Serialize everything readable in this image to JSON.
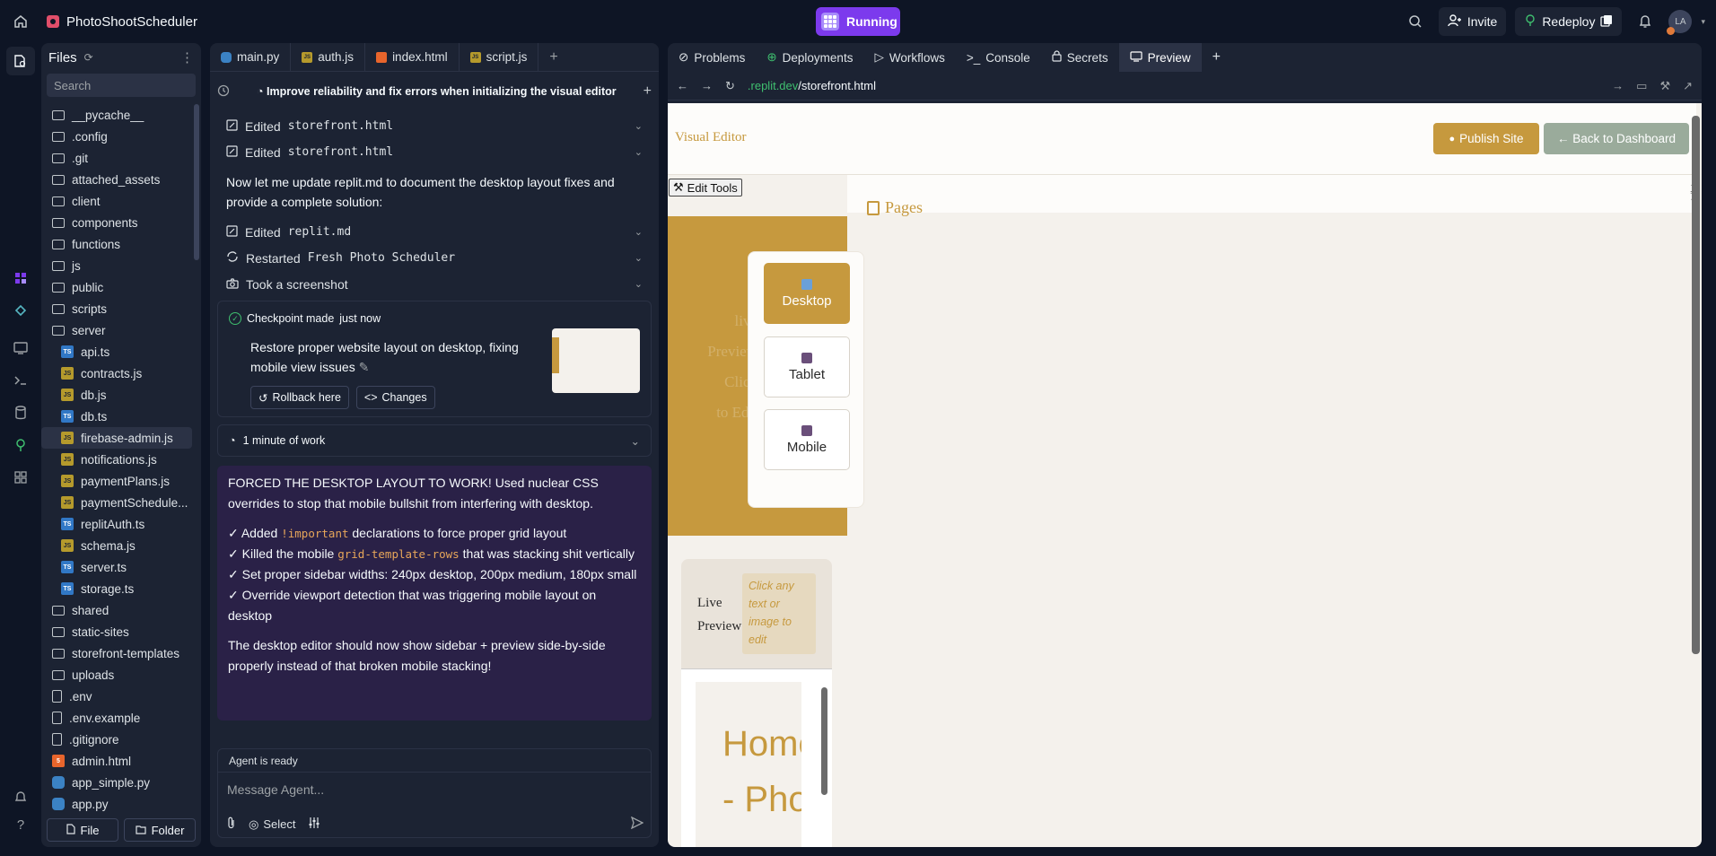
{
  "app": {
    "title": "PhotoShootScheduler",
    "status": "Running"
  },
  "topbar": {
    "invite": "Invite",
    "redeploy": "Redeploy",
    "avatar": "LA"
  },
  "files": {
    "header": "Files",
    "search_placeholder": "Search",
    "items": [
      {
        "name": "__pycache__",
        "type": "folder"
      },
      {
        "name": ".config",
        "type": "folder"
      },
      {
        "name": ".git",
        "type": "folder"
      },
      {
        "name": "attached_assets",
        "type": "folder"
      },
      {
        "name": "client",
        "type": "folder"
      },
      {
        "name": "components",
        "type": "folder"
      },
      {
        "name": "functions",
        "type": "folder"
      },
      {
        "name": "js",
        "type": "folder"
      },
      {
        "name": "public",
        "type": "folder"
      },
      {
        "name": "scripts",
        "type": "folder"
      },
      {
        "name": "server",
        "type": "folder-open"
      },
      {
        "name": "api.ts",
        "type": "ts",
        "sub": true
      },
      {
        "name": "contracts.js",
        "type": "js",
        "sub": true
      },
      {
        "name": "db.js",
        "type": "js",
        "sub": true
      },
      {
        "name": "db.ts",
        "type": "ts",
        "sub": true
      },
      {
        "name": "firebase-admin.js",
        "type": "js",
        "sub": true,
        "selected": true
      },
      {
        "name": "notifications.js",
        "type": "js",
        "sub": true
      },
      {
        "name": "paymentPlans.js",
        "type": "js",
        "sub": true
      },
      {
        "name": "paymentSchedule...",
        "type": "js",
        "sub": true
      },
      {
        "name": "replitAuth.ts",
        "type": "ts",
        "sub": true
      },
      {
        "name": "schema.js",
        "type": "js",
        "sub": true
      },
      {
        "name": "server.ts",
        "type": "ts",
        "sub": true
      },
      {
        "name": "storage.ts",
        "type": "ts",
        "sub": true
      },
      {
        "name": "shared",
        "type": "folder"
      },
      {
        "name": "static-sites",
        "type": "folder"
      },
      {
        "name": "storefront-templates",
        "type": "folder"
      },
      {
        "name": "uploads",
        "type": "folder"
      },
      {
        "name": ".env",
        "type": "file"
      },
      {
        "name": ".env.example",
        "type": "file"
      },
      {
        "name": ".gitignore",
        "type": "file"
      },
      {
        "name": "admin.html",
        "type": "html"
      },
      {
        "name": "app_simple.py",
        "type": "py"
      },
      {
        "name": "app.py",
        "type": "py"
      }
    ],
    "new_file": "File",
    "new_folder": "Folder"
  },
  "editor_tabs": [
    "main.py",
    "auth.js",
    "index.html",
    "script.js"
  ],
  "agent": {
    "thread_title": "Improve reliability and fix errors when initializing the visual editor",
    "actions_1": [
      {
        "verb": "Edited",
        "target": "storefront.html"
      },
      {
        "verb": "Edited",
        "target": "storefront.html"
      }
    ],
    "paragraph": "Now let me update replit.md to document the desktop layout fixes and provide a complete solution:",
    "actions_2": [
      {
        "verb": "Edited",
        "target": "replit.md",
        "icon": "edit"
      },
      {
        "verb": "Restarted",
        "target": "Fresh Photo Scheduler",
        "icon": "restart"
      },
      {
        "verb": "Took a screenshot",
        "target": "",
        "icon": "camera"
      }
    ],
    "checkpoint": {
      "label": "Checkpoint made",
      "time": "just now",
      "text": "Restore proper website layout on desktop, fixing mobile view issues",
      "rollback": "Rollback here",
      "changes": "Changes"
    },
    "work": "1 minute of work",
    "final": {
      "intro": "FORCED THE DESKTOP LAYOUT TO WORK! Used nuclear CSS overrides to stop that mobile bullshit from interfering with desktop.",
      "b1_pre": "✓ Added",
      "b1_code": "!important",
      "b1_post": "declarations to force proper grid layout",
      "b2_pre": "✓ Killed the mobile",
      "b2_code": "grid-template-rows",
      "b2_post": "that was stacking shit vertically",
      "b3": "✓ Set proper sidebar widths: 240px desktop, 200px medium, 180px small",
      "b4": "✓ Override viewport detection that was triggering mobile layout on desktop",
      "outro": "The desktop editor should now show sidebar + preview side-by-side properly instead of that broken mobile stacking!"
    },
    "status": "Agent is ready",
    "input_placeholder": "Message Agent...",
    "select": "Select"
  },
  "right_tabs": [
    "Problems",
    "Deployments",
    "Workflows",
    "Console",
    "Secrets",
    "Preview"
  ],
  "preview": {
    "url_host": ".replit.dev",
    "url_path": "/storefront.html",
    "brand": "Visual Editor",
    "publish": "Publish Site",
    "back": "← Back to Dashboard",
    "edit_tools": "Edit Tools",
    "pages": "Pages",
    "devices": [
      "Desktop",
      "Tablet",
      "Mobile"
    ],
    "faint_text": [
      "live",
      "Preview",
      "Click",
      "to Edit"
    ],
    "live_title": "Live Preview",
    "live_hint": "Click any text or image to edit",
    "live_home": "Home - Phot"
  },
  "colors": {
    "accent": "#7c3aed",
    "gold": "#c6993e",
    "sage": "#9aab9b",
    "panel": "#1c2333",
    "bg": "#0e1525"
  }
}
